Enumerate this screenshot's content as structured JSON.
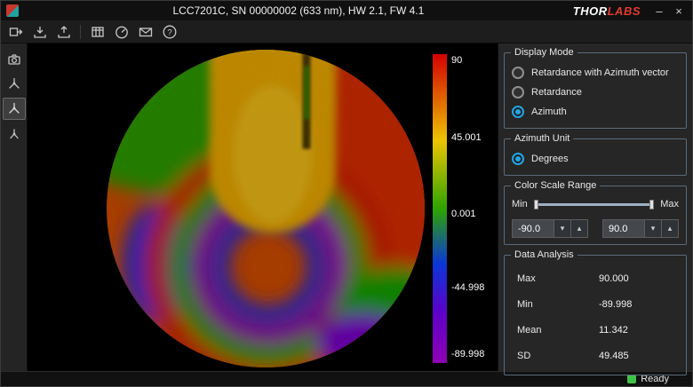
{
  "window": {
    "title": "LCC7201C, SN 00000002 (633 nm), HW 2.1, FW 4.1",
    "brand": {
      "thor": "THOR",
      "labs": "LABS"
    },
    "controls": {
      "minimize": "–",
      "close": "×"
    }
  },
  "toolbar": {
    "icons": [
      "measure-icon",
      "export-data-icon",
      "import-data-icon",
      "table-view-icon",
      "gauge-icon",
      "envelope-icon",
      "help-icon"
    ]
  },
  "sidebar": {
    "icons": [
      "camera-icon",
      "retardance-vector-view-icon",
      "azimuth-view-icon",
      "vector-view-icon"
    ],
    "selected_index": 2
  },
  "colorbar": {
    "labels": [
      "90",
      "45.001",
      "0.001",
      "-44.998",
      "-89.998"
    ],
    "gradient": [
      "#d40000 0%",
      "#e06000 14%",
      "#edc400 28%",
      "#2ea400 50%",
      "#0b36d8 68%",
      "#5f00c8 84%",
      "#8e00b4 100%"
    ]
  },
  "display_mode": {
    "title": "Display Mode",
    "options": [
      {
        "label": "Retardance with Azimuth vector",
        "selected": false
      },
      {
        "label": "Retardance",
        "selected": false
      },
      {
        "label": "Azimuth",
        "selected": true
      }
    ]
  },
  "azimuth_unit": {
    "title": "Azimuth Unit",
    "options": [
      {
        "label": "Degrees",
        "selected": true
      }
    ]
  },
  "color_scale": {
    "title": "Color Scale Range",
    "min_label": "Min",
    "max_label": "Max",
    "min_value": "-90.0",
    "max_value": "90.0",
    "spin_down": "▾",
    "spin_up": "▴"
  },
  "data_analysis": {
    "title": "Data Analysis",
    "rows": [
      {
        "label": "Max",
        "value": "90.000"
      },
      {
        "label": "Min",
        "value": "-89.998"
      },
      {
        "label": "Mean",
        "value": "11.342"
      },
      {
        "label": "SD",
        "value": "49.485"
      }
    ]
  },
  "status": {
    "text": "Ready",
    "indicator_color": "#3fc24a"
  },
  "colors": {
    "accent": "#2ba3dc",
    "group_border": "#5a6b7b"
  }
}
